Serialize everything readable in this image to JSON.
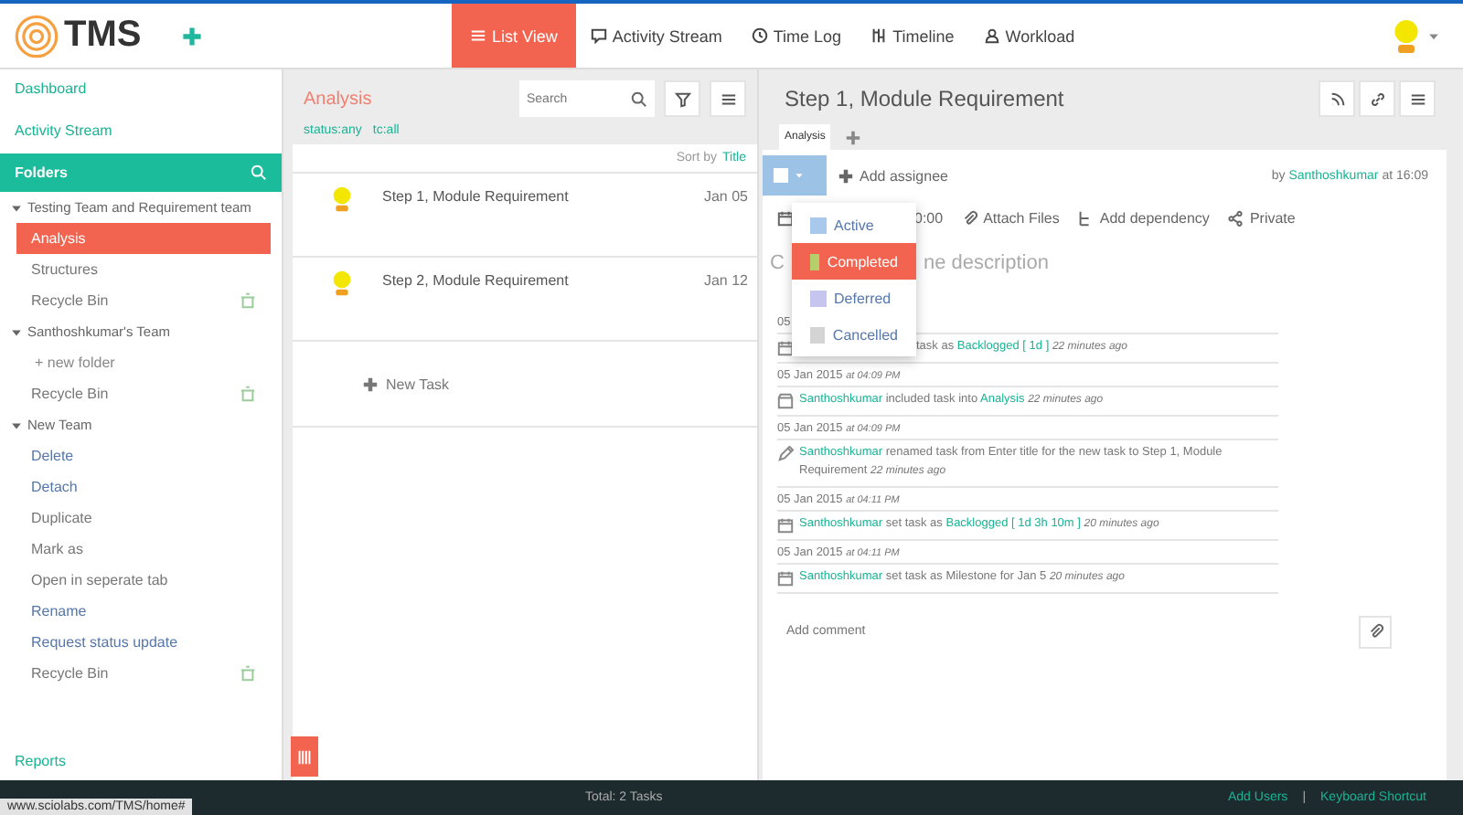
{
  "header": {
    "logo": "TMS",
    "nav": [
      {
        "label": "List View",
        "selected": true
      },
      {
        "label": "Activity Stream",
        "selected": false
      },
      {
        "label": "Time Log",
        "selected": false
      },
      {
        "label": "Timeline",
        "selected": false
      },
      {
        "label": "Workload",
        "selected": false
      }
    ]
  },
  "sidebar": {
    "links": [
      "Dashboard",
      "Activity Stream"
    ],
    "folders_title": "Folders",
    "tree": [
      {
        "label": "Testing Team and Requirement team",
        "expanded": true,
        "children": [
          {
            "label": "Analysis",
            "kind": "folder",
            "selected": true
          },
          {
            "label": "Structures",
            "kind": "folder",
            "selected": false
          },
          {
            "label": "Recycle Bin",
            "kind": "bin",
            "selected": false
          }
        ]
      },
      {
        "label": "Santhoshkumar's Team",
        "expanded": true,
        "children": [
          {
            "label": "+ new folder",
            "kind": "new",
            "selected": false
          },
          {
            "label": "Recycle Bin",
            "kind": "bin",
            "selected": false
          }
        ]
      },
      {
        "label": "New Team",
        "expanded": true,
        "children": [
          {
            "label": "Delete",
            "kind": "action",
            "selected": false
          },
          {
            "label": "Detach",
            "kind": "action",
            "selected": false
          },
          {
            "label": "Duplicate",
            "kind": "folder",
            "selected": false
          },
          {
            "label": "Mark as",
            "kind": "folder",
            "selected": false
          },
          {
            "label": "Open in seperate tab",
            "kind": "folder",
            "selected": false
          },
          {
            "label": "Rename",
            "kind": "action",
            "selected": false
          },
          {
            "label": "Request status update",
            "kind": "action",
            "selected": false
          },
          {
            "label": "Recycle Bin",
            "kind": "bin",
            "selected": false
          }
        ]
      }
    ],
    "footer_link": "Reports"
  },
  "list": {
    "title": "Analysis",
    "search": {
      "placeholder": "Search"
    },
    "filters": [
      "status:any",
      "tc:all"
    ],
    "sort": {
      "label": "Sort by",
      "value": "Title"
    },
    "tasks": [
      {
        "title": "Step 1, Module Requirement",
        "date": "Jan 05"
      },
      {
        "title": "Step 2, Module Requirement",
        "date": "Jan 12"
      }
    ],
    "new_task": "New Task"
  },
  "detail": {
    "title": "Step 1, Module Requirement",
    "tabs": [
      {
        "label": "Analysis",
        "selected": true
      }
    ],
    "status_checkbox": {
      "checked": false
    },
    "status_menu": {
      "open": true,
      "options": [
        {
          "label": "Active",
          "color": "#a9c9ec",
          "selected": false
        },
        {
          "label": "Completed",
          "color": "#b5cf6b",
          "selected": true
        },
        {
          "label": "Deferred",
          "color": "#c5c5f0",
          "selected": false
        },
        {
          "label": "Cancelled",
          "color": "#d4d4d4",
          "selected": false
        }
      ]
    },
    "add_assignee": "Add assignee",
    "byline": {
      "prefix": "by",
      "user": "Santhoshkumar",
      "suffix": "at 16:09"
    },
    "toolbar": [
      "0:00",
      "Attach Files",
      "Add dependency",
      "Private"
    ],
    "description": [
      "C",
      "ne description"
    ],
    "activity": [
      {
        "date": "05",
        "parts": [
          {
            "kind": "plain",
            "text": "task as"
          },
          {
            "kind": "link",
            "text": "Backlogged [ 1d ]"
          },
          {
            "kind": "ago",
            "text": "22 minutes ago"
          }
        ]
      },
      {
        "date": "05 Jan 2015",
        "time": "at 04:09 PM",
        "parts": [
          {
            "kind": "link",
            "text": "Santhoshkumar"
          },
          {
            "kind": "plain",
            "text": "included task into"
          },
          {
            "kind": "link",
            "text": "Analysis"
          },
          {
            "kind": "ago",
            "text": "22 minutes ago"
          }
        ]
      },
      {
        "date": "05 Jan 2015",
        "time": "at 04:09 PM",
        "parts": [
          {
            "kind": "link",
            "text": "Santhoshkumar"
          },
          {
            "kind": "plain",
            "text": "renamed task from Enter title for the new task to Step 1, Module Requirement"
          },
          {
            "kind": "ago",
            "text": "22 minutes ago"
          }
        ]
      },
      {
        "date": "05 Jan 2015",
        "time": "at 04:11 PM",
        "parts": [
          {
            "kind": "link",
            "text": "Santhoshkumar"
          },
          {
            "kind": "plain",
            "text": "set task as"
          },
          {
            "kind": "link",
            "text": "Backlogged [ 1d 3h 10m ]"
          },
          {
            "kind": "ago",
            "text": "20 minutes ago"
          }
        ]
      },
      {
        "date": "05 Jan 2015",
        "time": "at 04:11 PM",
        "parts": [
          {
            "kind": "link",
            "text": "Santhoshkumar"
          },
          {
            "kind": "plain",
            "text": "set task as Milestone for Jan 5"
          },
          {
            "kind": "ago",
            "text": "20 minutes ago"
          }
        ]
      }
    ],
    "comment": {
      "placeholder": "Add comment"
    }
  },
  "footer": {
    "status_url": "www.sciolabs.com/TMS/home#",
    "total": "Total: 2 Tasks",
    "links": [
      "Add Users",
      "Keyboard Shortcut"
    ],
    "separator": "|"
  }
}
